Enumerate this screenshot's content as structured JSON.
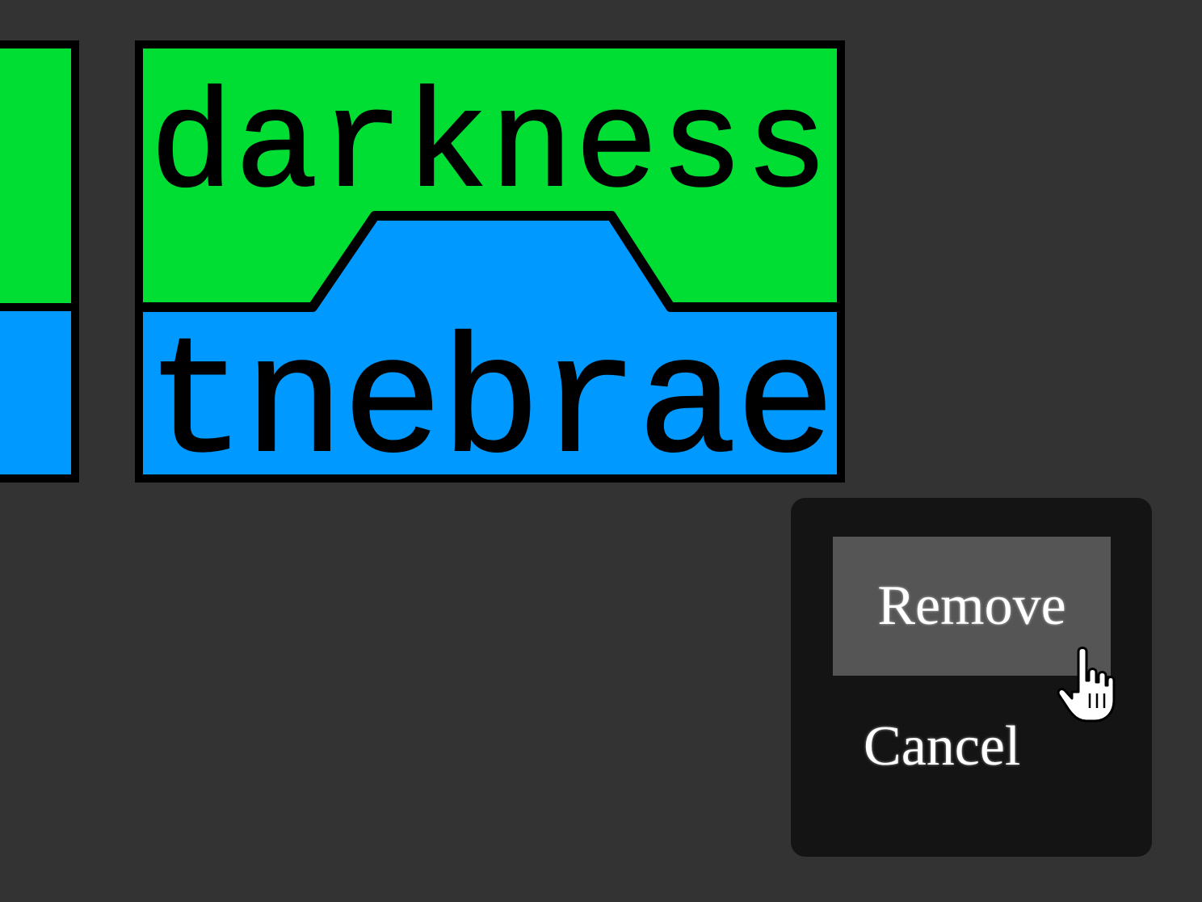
{
  "cards": {
    "main": {
      "top_word": "darkness",
      "bottom_word": "tnebrae",
      "top_color": "#00dd33",
      "bottom_color": "#0099ff",
      "border_color": "#000000"
    }
  },
  "context_menu": {
    "items": [
      {
        "label": "Remove",
        "state": "hovered"
      },
      {
        "label": "Cancel",
        "state": "normal"
      }
    ],
    "background": "#141414",
    "hover_background": "#555555"
  },
  "cursor": {
    "icon": "hand-pointer-icon"
  }
}
